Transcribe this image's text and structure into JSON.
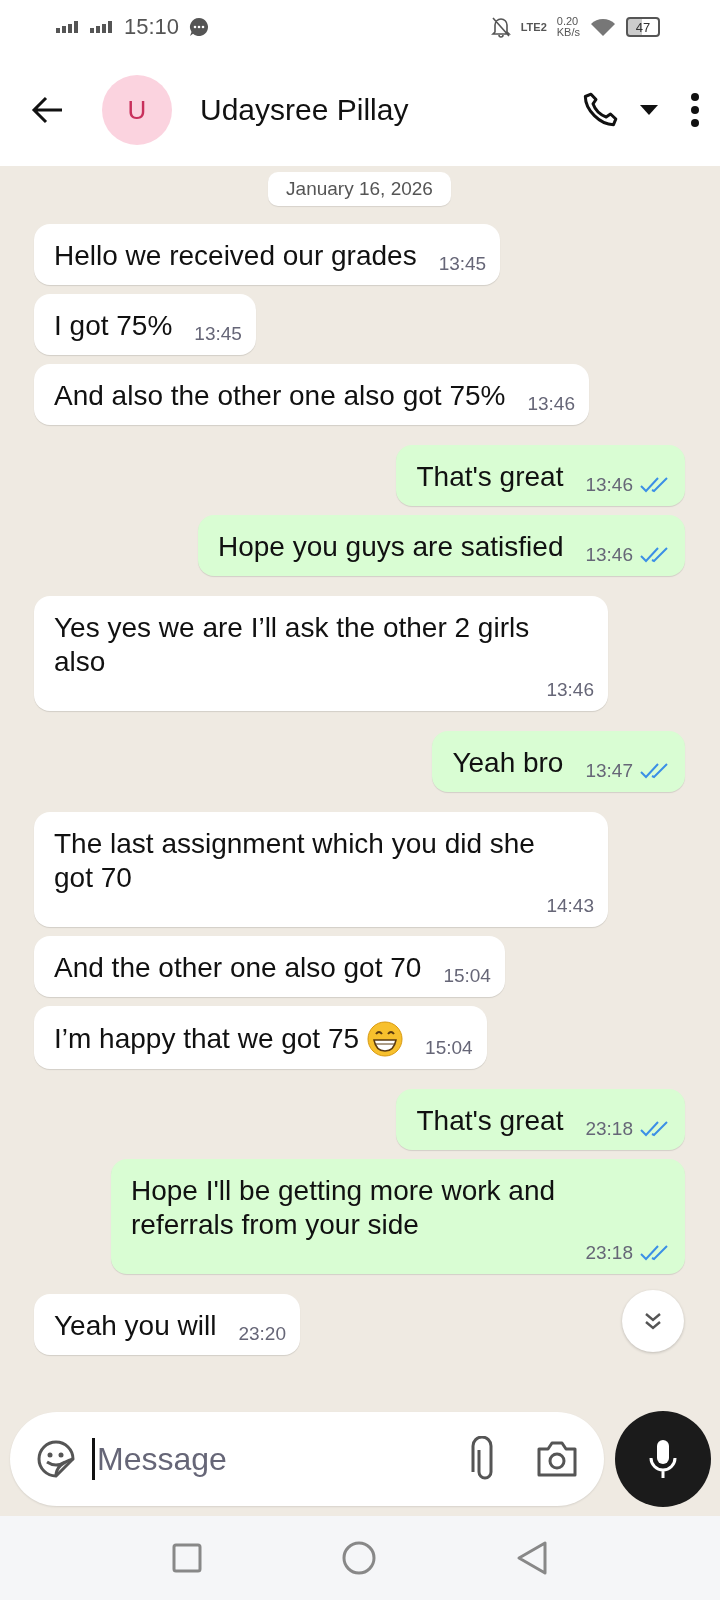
{
  "status_bar": {
    "time": "15:10",
    "network": "LTE2",
    "speed": "0.20",
    "speed_unit": "KB/s",
    "battery": "47"
  },
  "header": {
    "avatar_letter": "U",
    "name": "Udaysree Pillay"
  },
  "date_chip": "January 16, 2026",
  "messages": [
    {
      "kind": "in",
      "text": "Hello we received our grades",
      "time": "13:45"
    },
    {
      "kind": "in",
      "text": "I got 75%",
      "time": "13:45"
    },
    {
      "kind": "in",
      "text": "And also the other one also got 75%",
      "time": "13:46"
    },
    {
      "kind": "out",
      "text": "That's great",
      "time": "13:46",
      "read": true
    },
    {
      "kind": "out",
      "text": "Hope you guys are satisfied",
      "time": "13:46",
      "read": true
    },
    {
      "kind": "in",
      "text": "Yes yes we are I’ll ask the other 2 girls also",
      "time": "13:46"
    },
    {
      "kind": "out",
      "text": "Yeah bro",
      "time": "13:47",
      "read": true
    },
    {
      "kind": "in",
      "text": "The last assignment which you did she got 70",
      "time": "14:43"
    },
    {
      "kind": "in",
      "text": "And the other one also got 70",
      "time": "15:04"
    },
    {
      "kind": "in",
      "text": "I’m happy that we got 75",
      "time": "15:04",
      "with_emoji": true
    },
    {
      "kind": "out",
      "text": "That's great",
      "time": "23:18",
      "read": true
    },
    {
      "kind": "out",
      "text": "Hope I'll be getting more work and referrals from your side",
      "time": "23:18",
      "read": true
    },
    {
      "kind": "in",
      "text": "Yeah you will",
      "time": "23:20"
    }
  ],
  "composer": {
    "placeholder": "Message"
  }
}
